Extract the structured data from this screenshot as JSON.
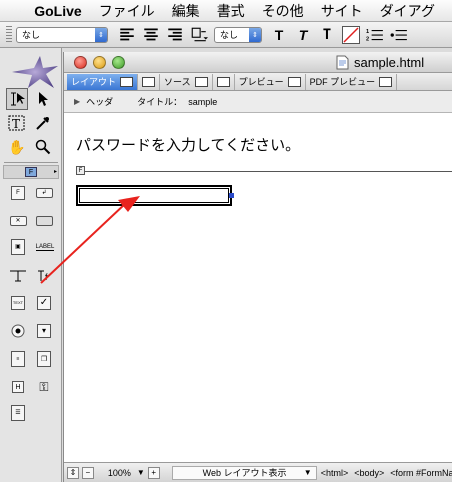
{
  "menubar": {
    "app": "GoLive",
    "items": [
      "ファイル",
      "編集",
      "書式",
      "その他",
      "サイト",
      "ダイアグ"
    ]
  },
  "toolbar": {
    "paragraph_format": "なし",
    "font_size": "なし"
  },
  "window": {
    "title": "sample.html"
  },
  "tabs": {
    "layout": "レイアウト",
    "source": "ソース",
    "preview": "プレビュー",
    "pdf_preview": "PDF プレビュー"
  },
  "headbar": {
    "head_label": "ヘッダ",
    "title_label": "タイトル：",
    "title_value": "sample"
  },
  "content": {
    "heading": "パスワードを入力してください。",
    "form_marker": "F"
  },
  "palette": {
    "form_tab": "F",
    "label_object": "LABEL",
    "text_object": "TEXT",
    "hidden_object": "H"
  },
  "statusbar": {
    "zoom": "100%",
    "view_mode": "Web レイアウト表示",
    "path_html": "<html>",
    "path_body": "<body>",
    "path_form": "<form #FormNa"
  },
  "colors": {
    "annotation_arrow": "#e8231e",
    "tab_active": "#3a76d4"
  }
}
